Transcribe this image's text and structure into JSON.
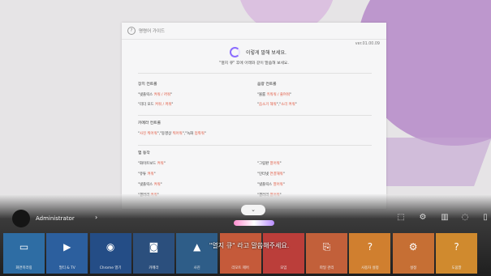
{
  "panel": {
    "title": "명령어 가이드",
    "version": "ver.01.00.09",
    "say_title": "이렇게 말해 보세요.",
    "say_sub": "\"열지 큐\" 후에 아래와 같이 말씀해 보세요.",
    "sections": [
      {
        "title": "장치 컨트롤",
        "items": [
          [
            "\"넷플릭스 ",
            "켜줘 / 꺼줘",
            "\""
          ],
          [
            "\"리더 모드 ",
            "켜줘 / 꺼줘",
            "\""
          ]
        ]
      },
      {
        "title": "음량 컨트롤",
        "items": [
          [
            "\"볼륨 ",
            "키워줘 / 줄여줘",
            "\""
          ],
          [
            "\"",
            "음소거 해줘",
            "\",\"",
            "소리 켜줘",
            "\""
          ]
        ]
      },
      {
        "title": "카메라 컨트롤",
        "items": [
          [
            "\"",
            "사진 찍어줘",
            "\",\"동영상 ",
            "찍어줘",
            "\",\"녹화 ",
            "멈춰줘",
            "\""
          ]
        ]
      },
      {
        "title": "앱 동작",
        "items": [
          [
            "\"화이트보드 ",
            "켜줘",
            "\""
          ],
          [
            "\"그림판 ",
            "열어줘",
            "\""
          ],
          [
            "\"유튜 ",
            "켜줘",
            "\""
          ],
          [
            "\"인터넷 ",
            "연결해줘",
            "\""
          ],
          [
            "\"넷플릭스 ",
            "켜줘",
            "\""
          ],
          [
            "\"넷플릭스 ",
            "열어줘",
            "\""
          ],
          [
            "\"갤러리 ",
            "켜줘",
            "\""
          ],
          [
            "\"갤러리 ",
            "열어줘",
            "\""
          ]
        ]
      }
    ]
  },
  "bottom": {
    "account": "Administrator",
    "chevron": "›",
    "collapse": "⌄",
    "voice_prompt": "\"열지 큐\" 라고 말씀해주세요.",
    "toolbar_icons": [
      "screen-icon",
      "settings-icon",
      "window-icon",
      "power-icon",
      "lock-icon"
    ],
    "tiles": [
      {
        "label": "화면미러링",
        "icon": "▭",
        "color": "#2e6da4"
      },
      {
        "label": "멀티 & TV",
        "icon": "▶",
        "color": "#2c5f9e"
      },
      {
        "label": "Chrome 열기",
        "icon": "◉",
        "color": "#244d86"
      },
      {
        "label": "카메라",
        "icon": "◙",
        "color": "#2b4f7d"
      },
      {
        "label": "사진",
        "icon": "▲",
        "color": "#2e5d88"
      },
      {
        "label": "리모트 제어",
        "icon": "",
        "color": "#c55a3a"
      },
      {
        "label": "모임",
        "icon": "",
        "color": "#bb3e3a"
      },
      {
        "label": "파일 관리",
        "icon": "⎘",
        "color": "#c2603a"
      },
      {
        "label": "사용자 설정",
        "icon": "?",
        "color": "#d07f2f"
      },
      {
        "label": "설정",
        "icon": "⚙",
        "color": "#c66f34"
      },
      {
        "label": "도움말",
        "icon": "?",
        "color": "#d08a2e"
      }
    ]
  }
}
